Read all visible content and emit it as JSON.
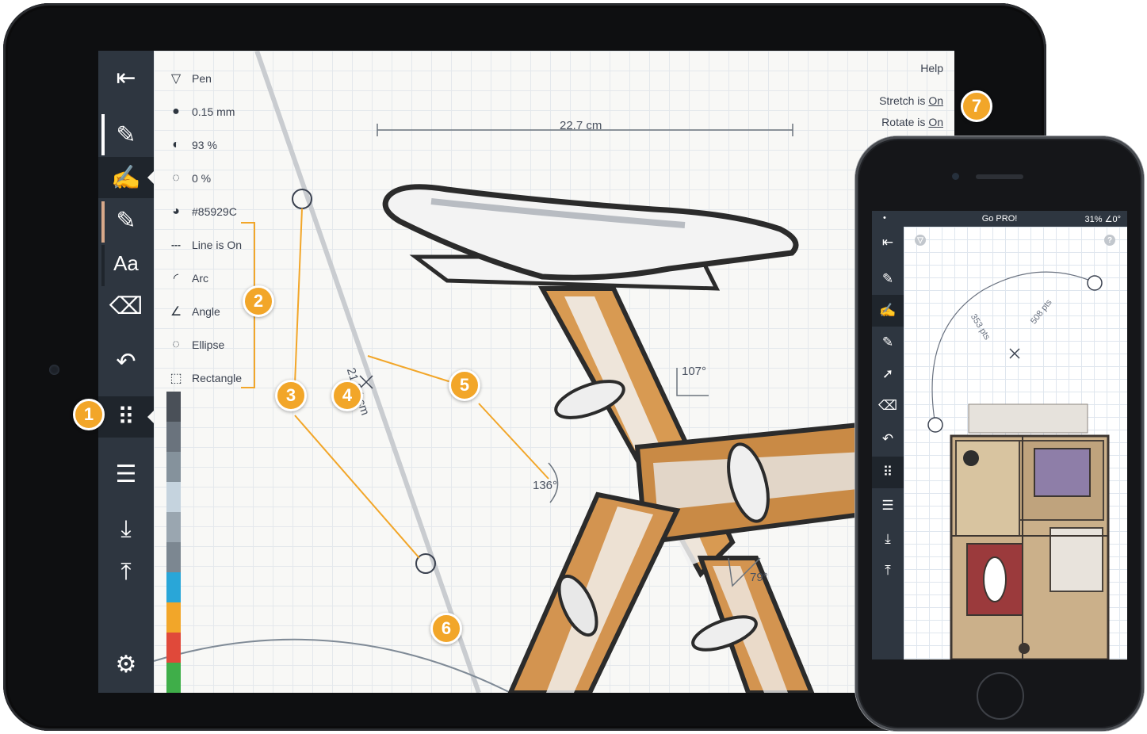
{
  "ipad": {
    "toolbar": {
      "items": [
        {
          "name": "toggle-panel-button",
          "icon": "panel-toggle-icon",
          "glyph": "⇤"
        },
        {
          "name": "pen-tool-1",
          "icon": "pen-brush-icon",
          "glyph": "✎"
        },
        {
          "name": "pen-tool-2",
          "icon": "pen-brush-icon",
          "glyph": "✍"
        },
        {
          "name": "pen-tool-3",
          "icon": "pen-brush-icon",
          "glyph": "✎"
        },
        {
          "name": "text-tool",
          "icon": "text-icon",
          "glyph": "Aa"
        },
        {
          "name": "eraser-tool",
          "icon": "eraser-icon",
          "glyph": "⌫"
        },
        {
          "name": "undo",
          "icon": "undo-icon",
          "glyph": "↶"
        },
        {
          "name": "grid-tool",
          "icon": "grid-icon",
          "glyph": "⠿"
        },
        {
          "name": "layers",
          "icon": "layers-icon",
          "glyph": "☰"
        },
        {
          "name": "import",
          "icon": "download-icon",
          "glyph": "⤓"
        },
        {
          "name": "export",
          "icon": "upload-icon",
          "glyph": "⤒"
        },
        {
          "name": "settings",
          "icon": "gear-icon",
          "glyph": "⚙"
        }
      ]
    },
    "pen_panel": {
      "rows": [
        {
          "icon": "pen-icon",
          "glyph": "▽",
          "label": "Pen"
        },
        {
          "icon": "size-icon",
          "glyph": "●",
          "label": "0.15 mm"
        },
        {
          "icon": "opacity-icon",
          "glyph": "◐",
          "label": "93 %"
        },
        {
          "icon": "rotation-icon",
          "glyph": "◌",
          "label": "0 %"
        },
        {
          "icon": "palette-icon",
          "glyph": "◕",
          "label": "#85929C"
        },
        {
          "icon": "line-icon",
          "glyph": "---",
          "label": "Line is On"
        },
        {
          "icon": "arc-icon",
          "glyph": "◜",
          "label": "Arc"
        },
        {
          "icon": "angle-icon",
          "glyph": "∠",
          "label": "Angle"
        },
        {
          "icon": "ellipse-icon",
          "glyph": "◌",
          "label": "Ellipse"
        },
        {
          "icon": "rectangle-icon",
          "glyph": "⬚",
          "label": "Rectangle"
        }
      ]
    },
    "palette_colors": [
      "#4a5058",
      "#6a737d",
      "#85929c",
      "#c5d3de",
      "#9aa6b0",
      "#7c8791",
      "#29a6d8",
      "#f2a629",
      "#e0493a",
      "#3fae49",
      "#f5d31c"
    ],
    "help_label": "Help",
    "stretch_label": "Stretch is",
    "stretch_value": "On",
    "rotate_label": "Rotate is",
    "rotate_value": "On",
    "measurements": {
      "width": "22.7 cm",
      "length": "21.04 cm",
      "angle_top": "107°",
      "angle_left": "136°",
      "angle_bottom": "79°"
    },
    "badges": [
      "1",
      "2",
      "3",
      "4",
      "5",
      "6",
      "7"
    ],
    "accent_color": "#f2a629"
  },
  "iphone": {
    "status": {
      "left": "•",
      "center": "Go PRO!",
      "right": "31% ∠0°"
    },
    "toolbar": {
      "items": [
        {
          "name": "toggle-panel-button",
          "icon": "panel-toggle-icon",
          "glyph": "⇤"
        },
        {
          "name": "pen-tool-1",
          "icon": "pen-brush-icon",
          "glyph": "✎"
        },
        {
          "name": "pen-tool-2",
          "icon": "pen-brush-icon",
          "glyph": "✍"
        },
        {
          "name": "pen-tool-3",
          "icon": "pen-brush-icon",
          "glyph": "✎"
        },
        {
          "name": "select-tool",
          "icon": "cursor-icon",
          "glyph": "➚"
        },
        {
          "name": "eraser-tool",
          "icon": "eraser-icon",
          "glyph": "⌫"
        },
        {
          "name": "undo",
          "icon": "undo-icon",
          "glyph": "↶"
        },
        {
          "name": "grid-tool",
          "icon": "grid-icon",
          "glyph": "⠿"
        },
        {
          "name": "layers",
          "icon": "layers-icon",
          "glyph": "☰"
        },
        {
          "name": "import",
          "icon": "download-icon",
          "glyph": "⤓"
        },
        {
          "name": "export",
          "icon": "upload-icon",
          "glyph": "⤒"
        }
      ]
    },
    "corner_left": "▽",
    "corner_right": "?",
    "measure_a": "353 pts",
    "measure_b": "508 pts"
  }
}
